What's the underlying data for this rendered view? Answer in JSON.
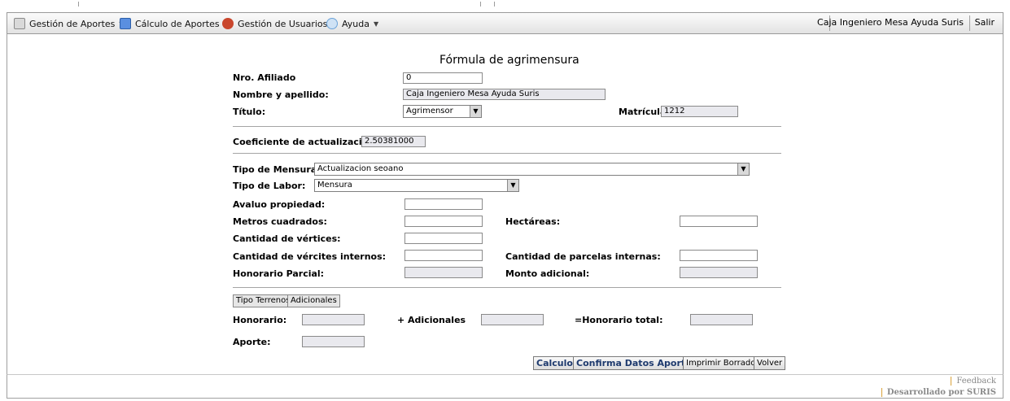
{
  "menu": {
    "items": [
      {
        "label": "Gestión de Aportes",
        "icon": "clipboard-icon",
        "color": "#8a8a8a"
      },
      {
        "label": "Cálculo de Aportes",
        "icon": "calculator-icon",
        "color": "#3a7bd5"
      },
      {
        "label": "Gestión de Usuarios",
        "icon": "users-icon",
        "color": "#c9462c"
      },
      {
        "label": "Ayuda",
        "icon": "help-icon",
        "color": "#6aa2d8"
      }
    ],
    "user": "Caja Ingeniero Mesa Ayuda Suris",
    "logout": "Salir"
  },
  "form": {
    "title": "Fórmula de agrimensura",
    "nro_afiliado_label": "Nro. Afiliado",
    "nro_afiliado_value": "0",
    "nombre_label": "Nombre y apellido:",
    "nombre_value": "Caja Ingeniero Mesa Ayuda Suris",
    "titulo_label": "Título:",
    "titulo_value": "Agrimensor",
    "matricula_label": "Matrícula",
    "matricula_value": "1212",
    "coef_label": "Coeficiente de actualizacion:",
    "coef_value": "2.50381000",
    "tipo_mensura_label": "Tipo de Mensura:",
    "tipo_mensura_value": "Actualizacion seoano",
    "tipo_labor_label": "Tipo de Labor:",
    "tipo_labor_value": "Mensura",
    "avaluo_label": "Avaluo propiedad:",
    "metros_label": "Metros cuadrados:",
    "hectareas_label": "Hectáreas:",
    "vertices_label": "Cantidad de vértices:",
    "vertices_int_label": "Cantidad de vércites internos:",
    "parcelas_label": "Cantidad de parcelas internas:",
    "hon_parcial_label": "Honorario Parcial:",
    "monto_label": "Monto adicional:",
    "tabs": [
      "Tipo Terrenos",
      "Adicionales"
    ],
    "honorario_label": "Honorario:",
    "adicionales_label": "+ Adicionales",
    "total_label": "=Honorario total:",
    "aporte_label": "Aporte:"
  },
  "buttons": {
    "calculo": "Calculo",
    "confirma": "Confirma Datos Aporte",
    "imprimir": "Imprimir Borrador",
    "volver": "Volver"
  },
  "footer": {
    "feedback": "Feedback",
    "credits": "Desarrollado por SURIS"
  }
}
